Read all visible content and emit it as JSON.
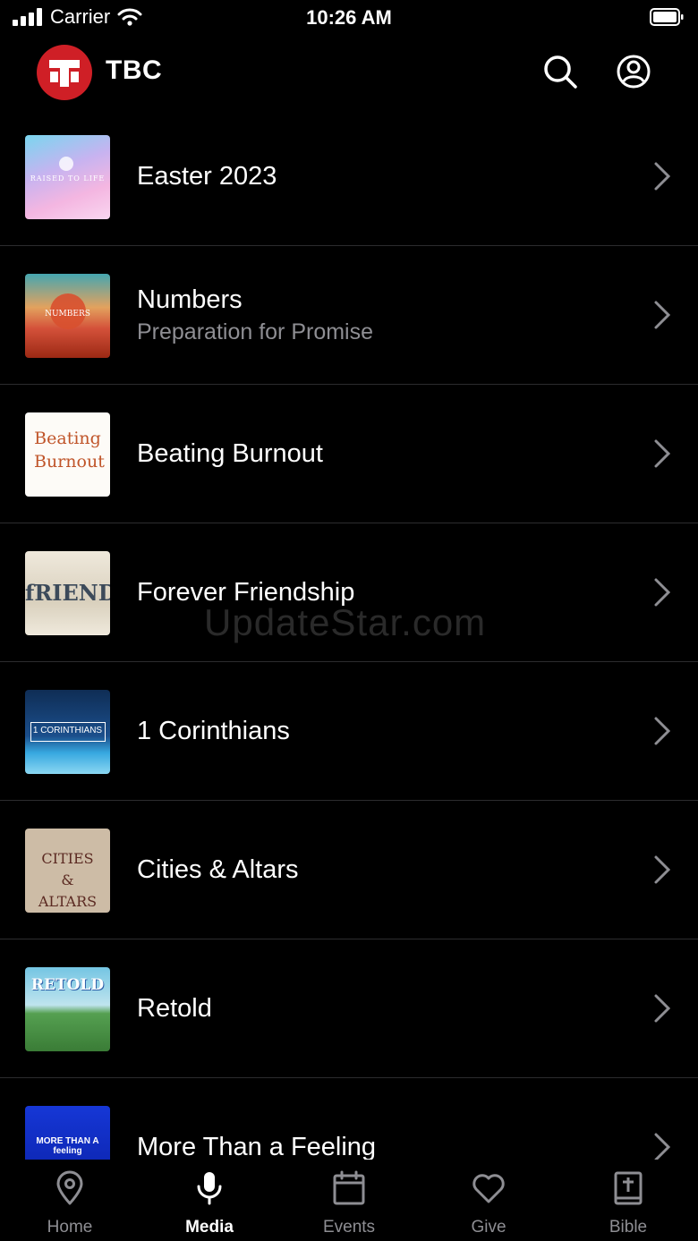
{
  "status_bar": {
    "carrier": "Carrier",
    "time": "10:26 AM"
  },
  "header": {
    "brand": "TBC"
  },
  "watermark": "UpdateStar.com",
  "series": [
    {
      "title": "Easter 2023",
      "subtitle": "",
      "thumb_text": "RAISED TO LIFE"
    },
    {
      "title": "Numbers",
      "subtitle": "Preparation for Promise",
      "thumb_text": "NUMBERS"
    },
    {
      "title": "Beating Burnout",
      "subtitle": "",
      "thumb_text": "Beating Burnout"
    },
    {
      "title": "Forever Friendship",
      "subtitle": "",
      "thumb_text": "fRIENDS"
    },
    {
      "title": "1 Corinthians",
      "subtitle": "",
      "thumb_text": "1 CORINTHIANS"
    },
    {
      "title": "Cities & Altars",
      "subtitle": "",
      "thumb_text": "CITIES & ALTARS"
    },
    {
      "title": "Retold",
      "subtitle": "",
      "thumb_text": "RETOLD"
    },
    {
      "title": "More Than a Feeling",
      "subtitle": "",
      "thumb_text": "MORE THAN A feeling"
    }
  ],
  "tabs": [
    {
      "label": "Home",
      "icon": "map-pin-icon",
      "active": false
    },
    {
      "label": "Media",
      "icon": "microphone-icon",
      "active": true
    },
    {
      "label": "Events",
      "icon": "calendar-icon",
      "active": false
    },
    {
      "label": "Give",
      "icon": "heart-icon",
      "active": false
    },
    {
      "label": "Bible",
      "icon": "bible-icon",
      "active": false
    }
  ],
  "colors": {
    "background": "#000000",
    "brand_red": "#cf1f26",
    "secondary_text": "#8e8e93",
    "separator": "#2c2c2e"
  }
}
